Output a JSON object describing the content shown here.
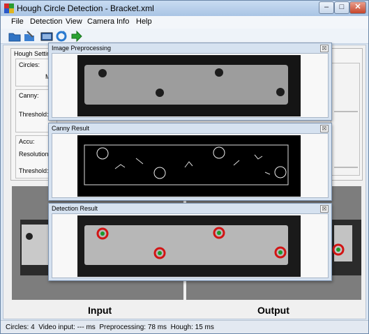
{
  "window": {
    "title": "Hough Circle Detection - Bracket.xml",
    "buttons": {
      "minimize": "–",
      "maximize": "□",
      "close": "✕"
    }
  },
  "menu": [
    "File",
    "Detection",
    "View",
    "Camera",
    "Info",
    "Help"
  ],
  "toolbar": {
    "icons": [
      "open-icon",
      "save-icon",
      "camera-icon",
      "refresh-icon",
      "run-arrow-icon"
    ]
  },
  "settings": {
    "group_title": "Hough Setting",
    "circles_label": "Circles:",
    "min_label": "Mi",
    "canny_label": "Canny:",
    "threshold_label": "Threshold:",
    "accu_label": "Accu:",
    "resolution_label": "Resolution:",
    "threshold2_label": "Threshold:"
  },
  "panes": {
    "input_label": "Input",
    "output_label": "Output"
  },
  "subwindows": {
    "preprocessing": {
      "title": "Image Preprocessing",
      "close": "☒"
    },
    "canny": {
      "title": "Canny Result",
      "close": "☒"
    },
    "detection": {
      "title": "Detection Result",
      "close": "☒"
    }
  },
  "status": {
    "circles_label": "Circles:",
    "circles_value": "4",
    "video_label": "Video input:",
    "video_value": "--- ms",
    "preproc_label": "Preprocessing:",
    "preproc_value": "78 ms",
    "hough_label": "Hough:",
    "hough_value": "15 ms"
  },
  "colors": {
    "accent": "#2b5a94",
    "detected_circle": "#d21414",
    "detected_center": "#1a9a2a"
  }
}
